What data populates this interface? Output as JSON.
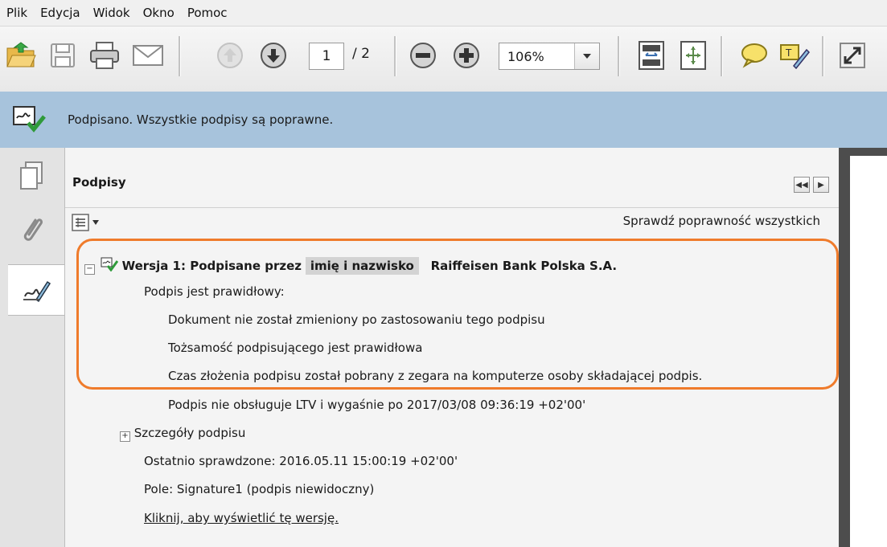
{
  "menu": [
    "Plik",
    "Edycja",
    "Widok",
    "Okno",
    "Pomoc"
  ],
  "toolbar": {
    "page_current": "1",
    "page_total": "/ 2",
    "zoom": "106%",
    "icons": [
      "open-icon",
      "save-icon",
      "print-icon",
      "email-icon",
      "previous-page-icon",
      "next-page-icon",
      "zoom-out-icon",
      "zoom-in-icon",
      "fit-page-icon",
      "fit-width-icon",
      "comment-icon",
      "highlight-icon",
      "fullscreen-icon"
    ]
  },
  "status": {
    "message": "Podpisano. Wszystkie podpisy są poprawne.",
    "color": "#a7c3dc"
  },
  "panel": {
    "title": "Podpisy",
    "verify_all": "Sprawdź poprawność wszystkich"
  },
  "signature": {
    "version_prefix": "Wersja 1: Podpisane przez",
    "signer_redacted": "imię i nazwisko",
    "organization": "Raiffeisen Bank Polska S.A.",
    "valid_heading": "Podpis jest prawidłowy:",
    "detail_1": "Dokument nie został zmieniony po zastosowaniu tego podpisu",
    "detail_2": "Tożsamość podpisującego jest prawidłowa",
    "detail_3": "Czas złożenia podpisu został pobrany z zegara na komputerze osoby składającej podpis.",
    "ltv_note": "Podpis nie obsługuje LTV i wygaśnie po 2017/03/08 09:36:19 +02'00'",
    "details_label": "Szczegóły podpisu",
    "last_checked": "Ostatnio sprawdzone: 2016.05.11 15:00:19 +02'00'",
    "field": "Pole: Signature1 (podpis niewidoczny)",
    "view_version_link": "Kliknij, aby wyświetlić tę wersję."
  },
  "highlight_color": "#ef7b2b"
}
